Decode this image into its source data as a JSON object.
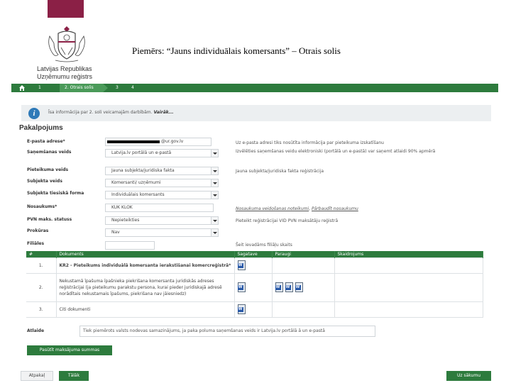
{
  "header": {
    "slide_title": "Piemērs: “Jauns individuālais komersants” – Otrais solis",
    "logo_line1": "Latvijas Republikas",
    "logo_line2": "Uzņēmumu reģistrs"
  },
  "steps": [
    {
      "label": "1"
    },
    {
      "label": "2. Otrais solis",
      "active": true
    },
    {
      "label": "3"
    },
    {
      "label": "4"
    }
  ],
  "info": {
    "text": "Īsa informācija par 2. soli veicamajām darbībām.",
    "more_label": "Vairāk..."
  },
  "section_title": "Pakalpojums",
  "form": {
    "email": {
      "label": "E-pasta adrese*",
      "value": "@ur.gov.lv",
      "note": "Uz e-pasta adresi tiks nosūtīta informācija par pieteikuma izskatīšanu"
    },
    "receive": {
      "label": "Saņemšanas veids",
      "value": "Latvija.lv portālā un e-pastā",
      "note": "Izvēlēties saņemšanas veidu elektroniski (portālā un e-pastā) var saņemt atlaidi 90% apmērā"
    },
    "application": {
      "label": "Pieteikuma veids",
      "value": "Jauna subjekta/juridiska fakta",
      "note": "Jauna subjekta/juridiska fakta reģistrācija"
    },
    "subject": {
      "label": "Subjekta veids",
      "value": "Komersanti/ uzņēmumi"
    },
    "legal_form": {
      "label": "Subjekta tiesiskā forma",
      "value": "Individuālais komersants"
    },
    "name": {
      "label": "Nosaukums*",
      "value": "KUK KLOK",
      "note_link1": "Nosaukuma veidošanas noteikumi",
      "note_sep": ",",
      "note_link2": "Pārbaudīt nosaukumu"
    },
    "vat": {
      "label": "PVN maks. statuss",
      "value": "Nepieteikties",
      "note": "Pieteikt reģistrācijai VID PVN maksātāju reģistrā"
    },
    "procura": {
      "label": "Prokūras",
      "value": "Nav"
    },
    "branches": {
      "label": "Filiāles",
      "value": "",
      "note": "Šeit ievadāms filiāļu skaits"
    }
  },
  "doc_table": {
    "headers": [
      "#",
      "Dokuments",
      "Sagatave",
      "Paraugi",
      "Skaidrojums"
    ],
    "rows": [
      {
        "num": "1.",
        "doc": "KR2 - Pieteikums individuālā komersanta ierakstīšanai komercreģistrā*"
      },
      {
        "num": "2.",
        "doc": "Nekustamā īpašuma īpašnieka piekrišana komersanta juridiskās adreses reģistrācijai (ja pieteikumu parakstu persona, kurai pieder juridiskajā adresē norādītais nekustamais īpašums, piekrišana nav jāiesniedz)"
      },
      {
        "num": "3.",
        "doc": "Citi dokumenti"
      }
    ]
  },
  "discount": {
    "label": "Atlaide",
    "text": "Tiek piemērots valsts nodevas samazinājums, ja paka poluma saņemšanas veids ir Latvija.lv portālā ā un e-pastā"
  },
  "buttons": {
    "payment": "Pasūtīt maksājuma summas",
    "back": "Atpakaļ",
    "next": "Tālāk",
    "start": "Uz sākumu"
  },
  "colors": {
    "brand": "#8b2046",
    "green": "#2d7b3d",
    "info": "#2f7ab8"
  }
}
